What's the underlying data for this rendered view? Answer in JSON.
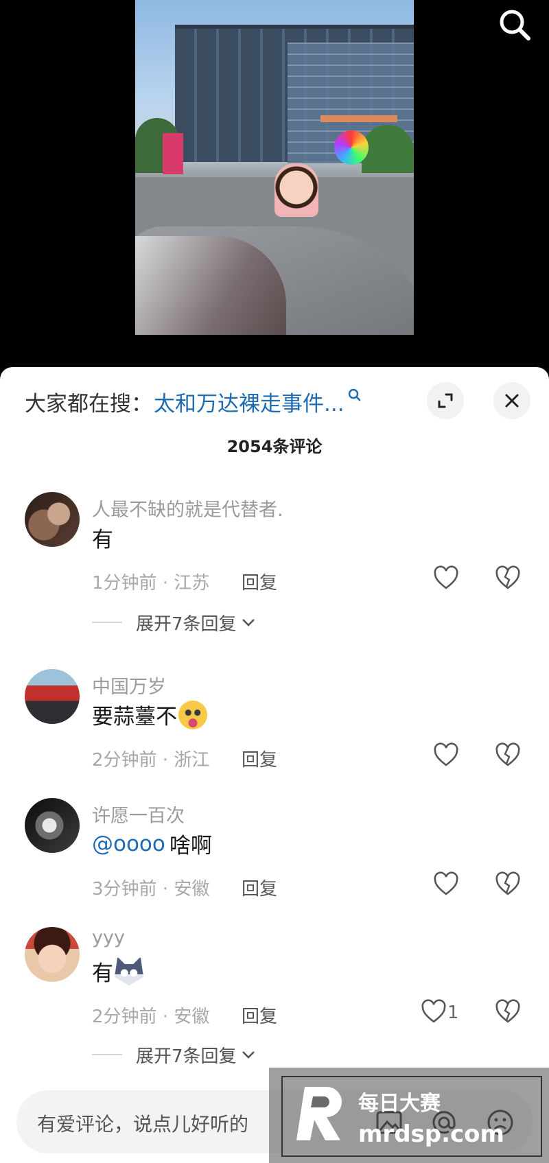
{
  "hot_search": {
    "prefix": "大家都在搜：",
    "query": "太和万达裸走事件..."
  },
  "comment_count_title": "2054条评论",
  "comments": [
    {
      "user": "人最不缺的就是代替者.",
      "text": "有",
      "meta": "1分钟前 · 江苏",
      "reply_label": "回复",
      "expand_label": "展开7条回复",
      "avatar": "avatar-smoking-woman"
    },
    {
      "user": "中国万岁",
      "text": "要蒜薹不",
      "emoji": "dizzy-face-emoji",
      "meta": "2分钟前 · 浙江",
      "reply_label": "回复",
      "avatar": "avatar-street-bus"
    },
    {
      "user": "许愿一百次",
      "mention": "@oooo",
      "text": "啥啊",
      "meta": "3分钟前 · 安徽",
      "reply_label": "回复",
      "avatar": "avatar-black-cat"
    },
    {
      "user": "yyy",
      "text": "有",
      "emoji": "wolf-emoji",
      "meta": "2分钟前 · 安徽",
      "reply_label": "回复",
      "like_count": "1",
      "expand_label": "展开7条回复",
      "avatar": "avatar-child"
    }
  ],
  "input": {
    "placeholder": "有爱评论，说点儿好听的"
  },
  "watermark": {
    "cn": "每日大赛",
    "en": "mrdsp.com"
  },
  "colors": {
    "link": "#1d6bb5",
    "sheet_bg": "#ffffff",
    "page_bg": "#000000"
  }
}
